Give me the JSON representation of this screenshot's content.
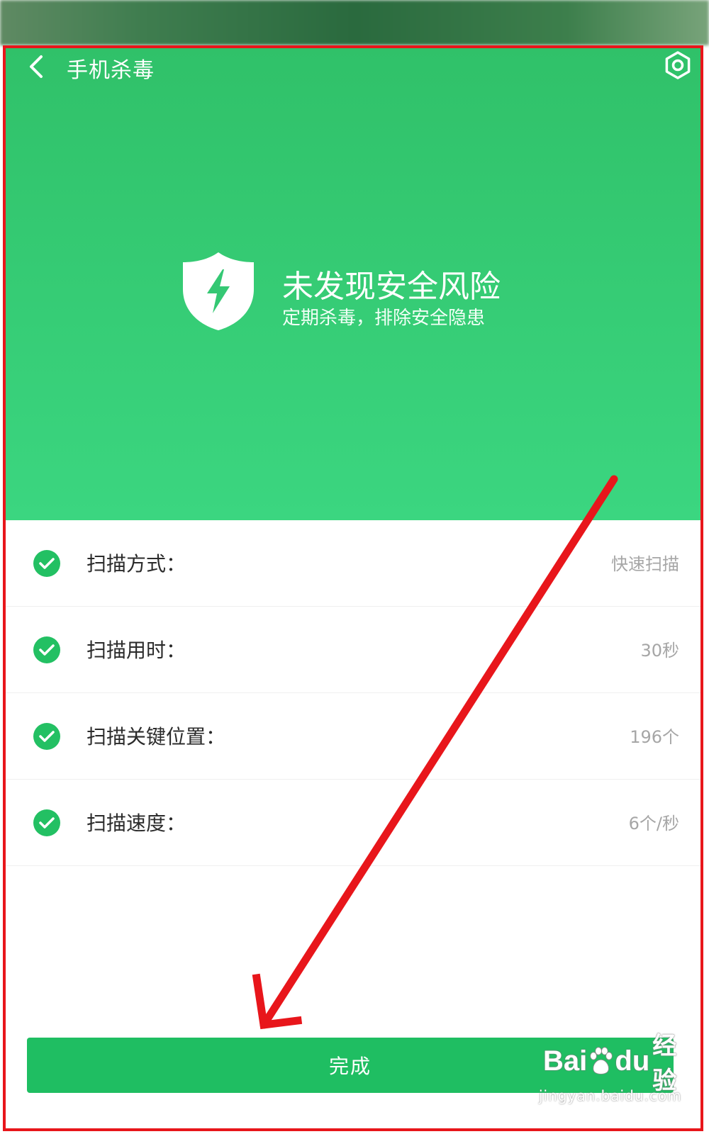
{
  "toolbar": {
    "title": "手机杀毒",
    "back_icon": "chevron-left-icon",
    "settings_icon": "hex-gear-icon"
  },
  "status": {
    "icon": "shield-bolt-icon",
    "title": "未发现安全风险",
    "subtitle": "定期杀毒，排除安全隐患"
  },
  "scan_results": [
    {
      "label": "扫描方式：",
      "value": "快速扫描"
    },
    {
      "label": "扫描用时：",
      "value": "30秒"
    },
    {
      "label": "扫描关键位置：",
      "value": "196个"
    },
    {
      "label": "扫描速度：",
      "value": "6个/秒"
    }
  ],
  "done_button": {
    "label": "完成"
  },
  "watermark": {
    "logo_text_left": "Bai",
    "logo_text_right": "du",
    "brand_cn": "经验",
    "url": "jingyan.baidu.com"
  },
  "colors": {
    "hero_top": "#30c169",
    "hero_bottom": "#3bd680",
    "button": "#1fbe62",
    "check": "#23c063",
    "annotation_red": "#e8161b"
  }
}
